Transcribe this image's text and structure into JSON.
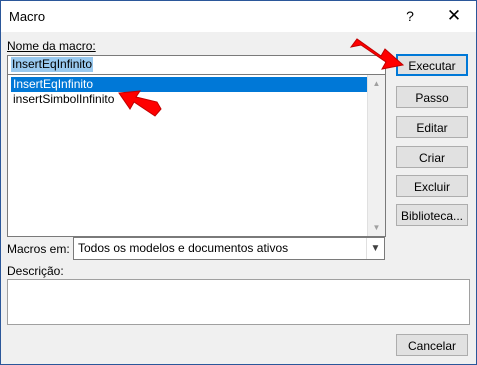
{
  "window": {
    "title": "Macro",
    "help_glyph": "?",
    "close_glyph": "✕"
  },
  "macro_name": {
    "label": "Nome da macro:",
    "value": "InsertEqInfinito"
  },
  "macro_list": {
    "items": [
      "InsertEqInfinito",
      "insertSimbolInfinito"
    ],
    "selected_index": 0
  },
  "buttons": {
    "run": "Executar",
    "step": "Passo",
    "edit": "Editar",
    "create": "Criar",
    "delete": "Excluir",
    "library": "Biblioteca...",
    "cancel": "Cancelar"
  },
  "macros_in": {
    "label": "Macros em:",
    "value": "Todos os modelos e documentos ativos"
  },
  "description": {
    "label": "Descrição:",
    "value": ""
  },
  "colors": {
    "selection": "#0078d7",
    "annotation_arrow": "#ff0000"
  }
}
